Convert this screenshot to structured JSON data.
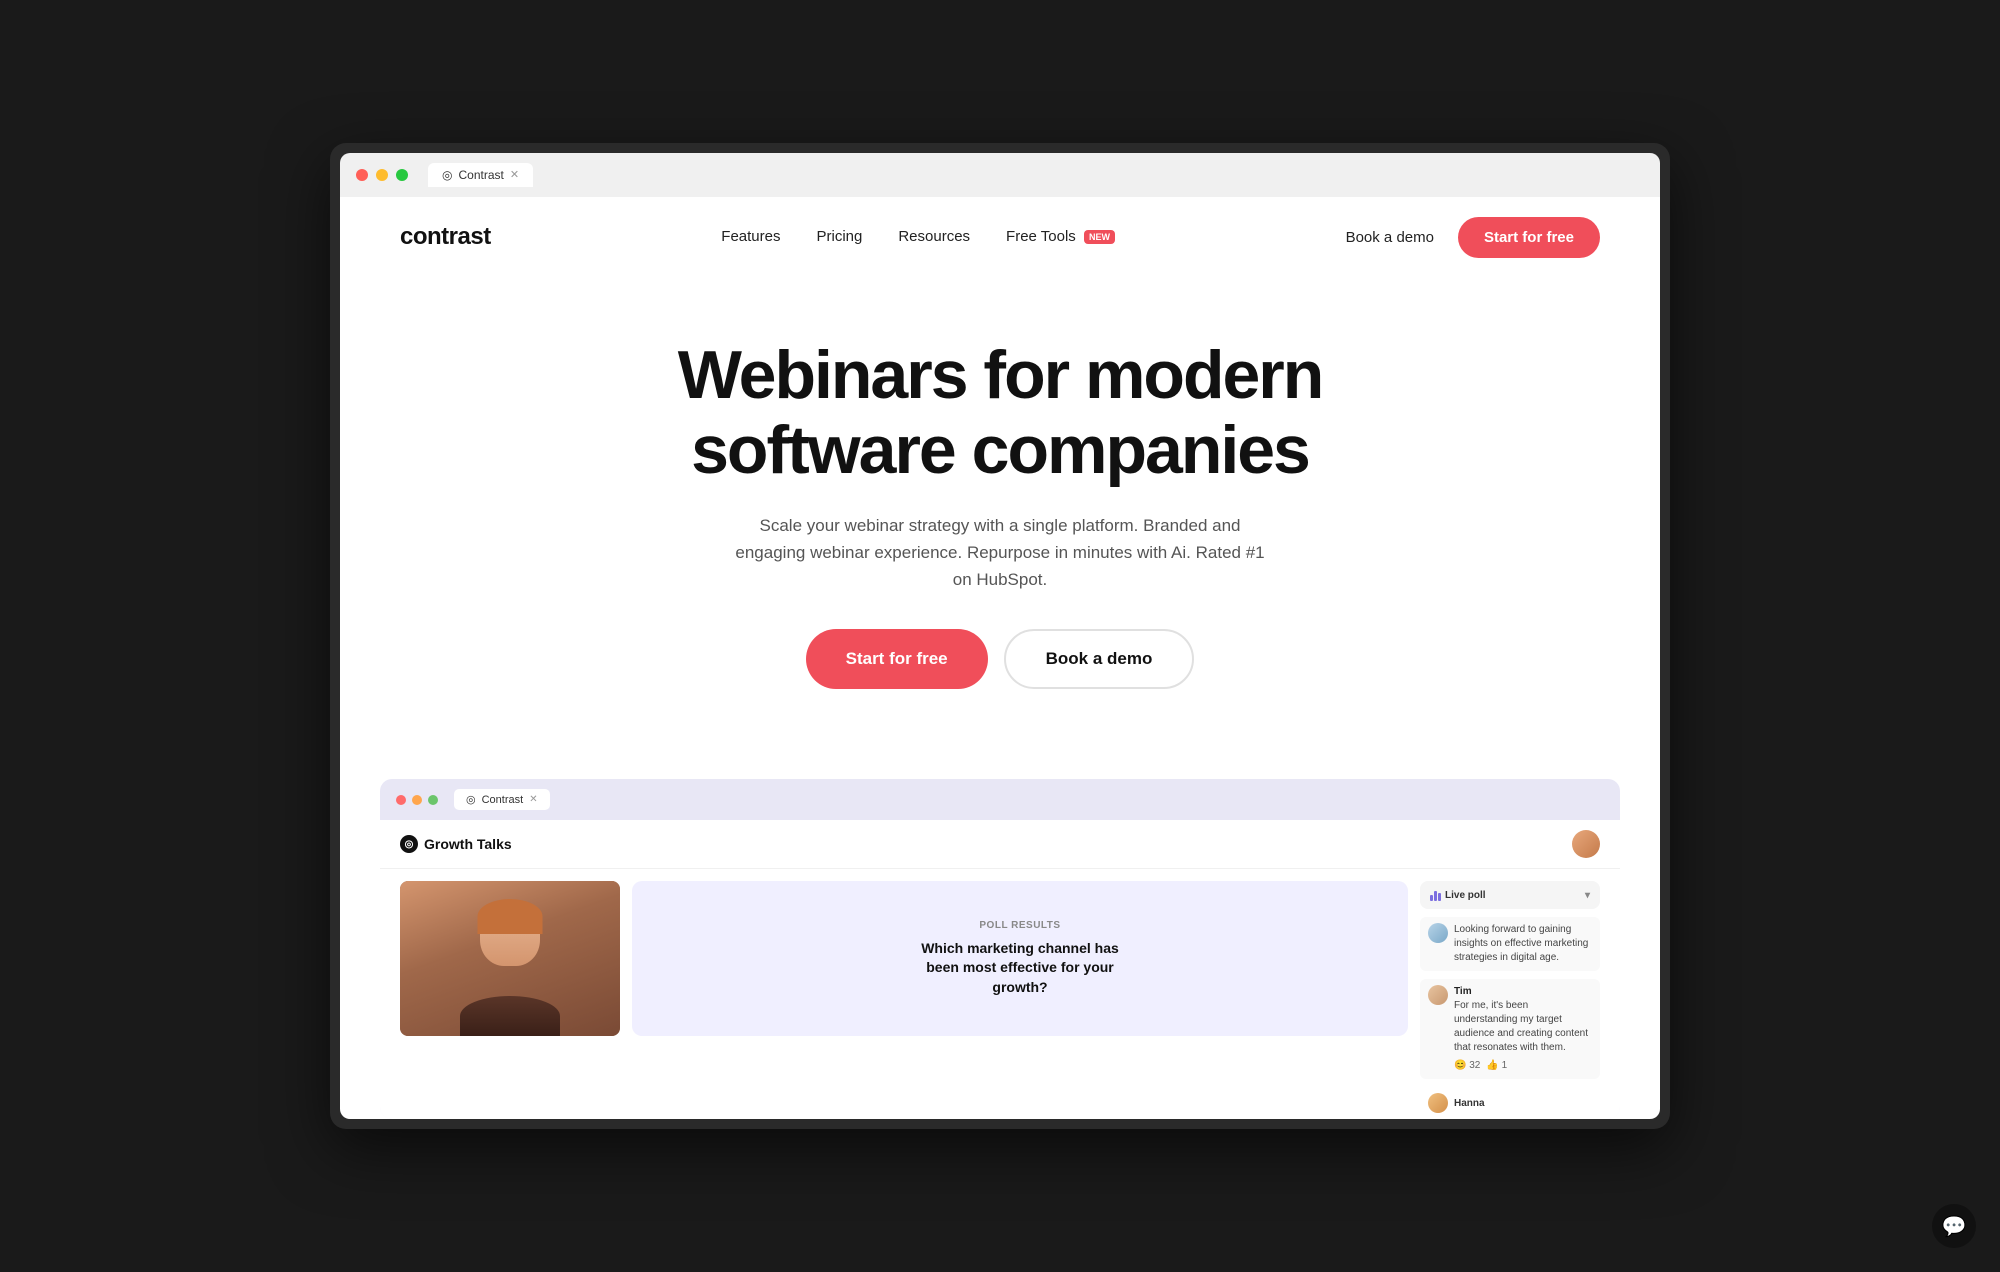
{
  "screen": {
    "bg": "#1a1a1a"
  },
  "browser": {
    "tab_logo": "◎",
    "tab_label": "Contrast",
    "tab_close": "✕"
  },
  "nav": {
    "logo": "contrast",
    "links": [
      {
        "id": "features",
        "label": "Features"
      },
      {
        "id": "pricing",
        "label": "Pricing"
      },
      {
        "id": "resources",
        "label": "Resources"
      },
      {
        "id": "free-tools",
        "label": "Free Tools",
        "badge": "new"
      }
    ],
    "book_demo": "Book a demo",
    "start_free": "Start for free"
  },
  "hero": {
    "headline_line1": "Webinars for modern",
    "headline_line2": "software companies",
    "subtext": "Scale your webinar strategy with a single platform. Branded and engaging webinar experience. Repurpose in minutes with Ai. Rated #1 on HubSpot.",
    "cta_primary": "Start for free",
    "cta_secondary": "Book a demo"
  },
  "mockup": {
    "traffic_lights": [
      "#ff6b6b",
      "#ffa64d",
      "#6bc56b"
    ],
    "tab_icon": "◎",
    "tab_label": "Contrast",
    "tab_close": "✕",
    "header_logo": "Growth Talks",
    "poll": {
      "label": "POLL RESULTS",
      "question": "Which marketing channel has been most effective for your growth?"
    },
    "sidebar": {
      "live_poll_label": "Live poll",
      "messages": [
        {
          "name": "",
          "text": "Looking forward to gaining insights on effective marketing strategies in digital age."
        },
        {
          "name": "Tim",
          "text": "For me, it's been understanding my target audience and creating content that resonates with them.",
          "reactions": [
            "😊 32",
            "👍 1"
          ]
        }
      ],
      "hanna": "Hanna"
    }
  },
  "chat_widget": {
    "icon": "💬"
  }
}
